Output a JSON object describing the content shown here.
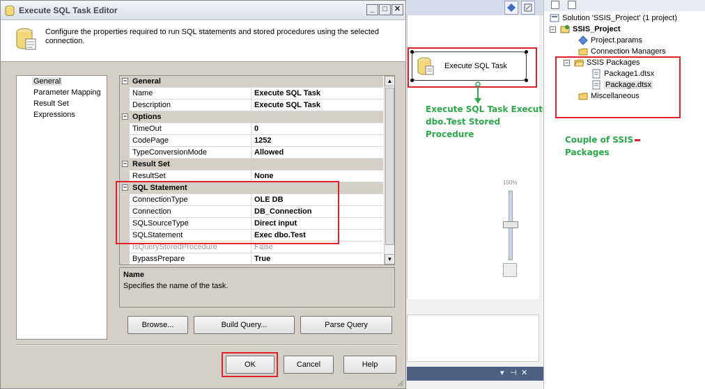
{
  "dialog": {
    "title": "Execute SQL Task Editor",
    "header_text": "Configure the properties required to run SQL statements and stored procedures using the selected connection.",
    "nav_items": [
      "General",
      "Parameter Mapping",
      "Result Set",
      "Expressions"
    ],
    "selected_nav": "General",
    "properties": [
      {
        "kind": "category",
        "label": "General"
      },
      {
        "kind": "prop",
        "name": "Name",
        "value": "Execute SQL Task"
      },
      {
        "kind": "prop",
        "name": "Description",
        "value": "Execute SQL Task"
      },
      {
        "kind": "category",
        "label": "Options"
      },
      {
        "kind": "prop",
        "name": "TimeOut",
        "value": "0"
      },
      {
        "kind": "prop",
        "name": "CodePage",
        "value": "1252"
      },
      {
        "kind": "prop",
        "name": "TypeConversionMode",
        "value": "Allowed"
      },
      {
        "kind": "category",
        "label": "Result Set"
      },
      {
        "kind": "prop",
        "name": "ResultSet",
        "value": "None"
      },
      {
        "kind": "category",
        "label": "SQL Statement"
      },
      {
        "kind": "prop",
        "name": "ConnectionType",
        "value": "OLE DB"
      },
      {
        "kind": "prop",
        "name": "Connection",
        "value": "DB_Connection"
      },
      {
        "kind": "prop",
        "name": "SQLSourceType",
        "value": "Direct input"
      },
      {
        "kind": "prop",
        "name": "SQLStatement",
        "value": "Exec dbo.Test"
      },
      {
        "kind": "prop",
        "name": "IsQueryStoredProcedure",
        "value": "False",
        "disabled": true
      },
      {
        "kind": "prop",
        "name": "BypassPrepare",
        "value": "True"
      }
    ],
    "description": {
      "title": "Name",
      "text": "Specifies the name of the task."
    },
    "buttons": {
      "browse": "Browse...",
      "build_query": "Build Query...",
      "parse_query": "Parse Query",
      "ok": "OK",
      "cancel": "Cancel",
      "help": "Help"
    }
  },
  "designer": {
    "task_label": "Execute SQL Task",
    "annotation": [
      "Execute SQL Task Execute",
      "dbo.Test Stored",
      "Procedure"
    ],
    "zoom_label": "100%"
  },
  "solution_explorer": {
    "items": [
      {
        "label": "Solution 'SSIS_Project' (1 project)",
        "icon": "solution-icon"
      },
      {
        "label": "SSIS_Project",
        "icon": "project-icon",
        "bold": true
      },
      {
        "label": "Project.params",
        "icon": "params-icon"
      },
      {
        "label": "Connection Managers",
        "icon": "folder-icon"
      },
      {
        "label": "SSIS Packages",
        "icon": "folder-open-icon"
      },
      {
        "label": "Package1.dtsx",
        "icon": "package-icon"
      },
      {
        "label": "Package.dtsx",
        "icon": "package-icon",
        "selected": true
      },
      {
        "label": "Miscellaneous",
        "icon": "folder-icon"
      }
    ],
    "annotation": [
      "Couple of SSIS",
      "Packages"
    ]
  },
  "colors": {
    "highlight": "#e0202a",
    "annotation": "#2aa84a"
  }
}
